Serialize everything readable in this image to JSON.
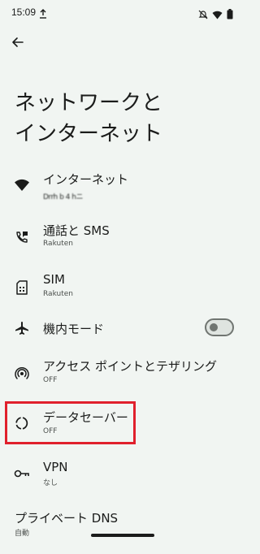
{
  "status_bar": {
    "time": "15:09",
    "upload_icon": "upload-arrow-icon",
    "icons": [
      "dnd-off-icon",
      "wifi-icon",
      "battery-icon"
    ]
  },
  "header": {
    "back_icon": "arrow-back-icon",
    "title": "ネットワークと\nインターネット"
  },
  "items": [
    {
      "icon": "wifi-icon",
      "title": "インターネット",
      "subtitle": "Drrh b 4 hニ"
    },
    {
      "icon": "call-sms-icon",
      "title": "通話と SMS",
      "subtitle": "Rakuten"
    },
    {
      "icon": "sim-card-icon",
      "title": "SIM",
      "subtitle": "Rakuten"
    },
    {
      "icon": "airplane-icon",
      "title": "機内モード",
      "toggle_state": "off"
    },
    {
      "icon": "hotspot-icon",
      "title": "アクセス ポイントとテザリング",
      "subtitle": "OFF"
    },
    {
      "icon": "data-saver-icon",
      "title": "データセーバー",
      "subtitle": "OFF"
    },
    {
      "icon": "vpn-key-icon",
      "title": "VPN",
      "subtitle": "なし"
    },
    {
      "title": "プライベート DNS",
      "subtitle": "自動"
    }
  ],
  "colors": {
    "background": "#f1f5f2",
    "text": "#1b1c1b",
    "subtext": "#4c504d",
    "highlight": "#e0202c"
  }
}
